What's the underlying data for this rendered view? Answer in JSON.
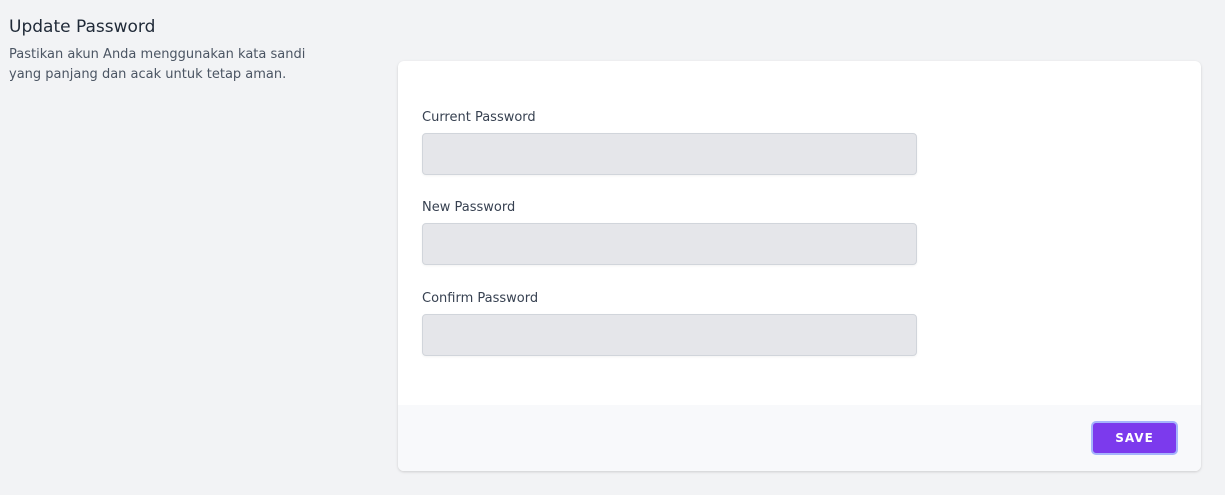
{
  "section": {
    "title": "Update Password",
    "description": "Pastikan akun Anda menggunakan kata sandi yang panjang dan acak untuk tetap aman."
  },
  "form": {
    "fields": [
      {
        "label": "Current Password",
        "value": "",
        "placeholder": ""
      },
      {
        "label": "New Password",
        "value": "",
        "placeholder": ""
      },
      {
        "label": "Confirm Password",
        "value": "",
        "placeholder": ""
      }
    ]
  },
  "footer": {
    "save_label": "SAVE"
  },
  "colors": {
    "page_background": "#f2f3f5",
    "card_background": "#ffffff",
    "input_background": "#e5e6ea",
    "footer_background": "#f8f9fb",
    "accent": "#7c3aed",
    "focus_ring": "#a5b4fc"
  }
}
